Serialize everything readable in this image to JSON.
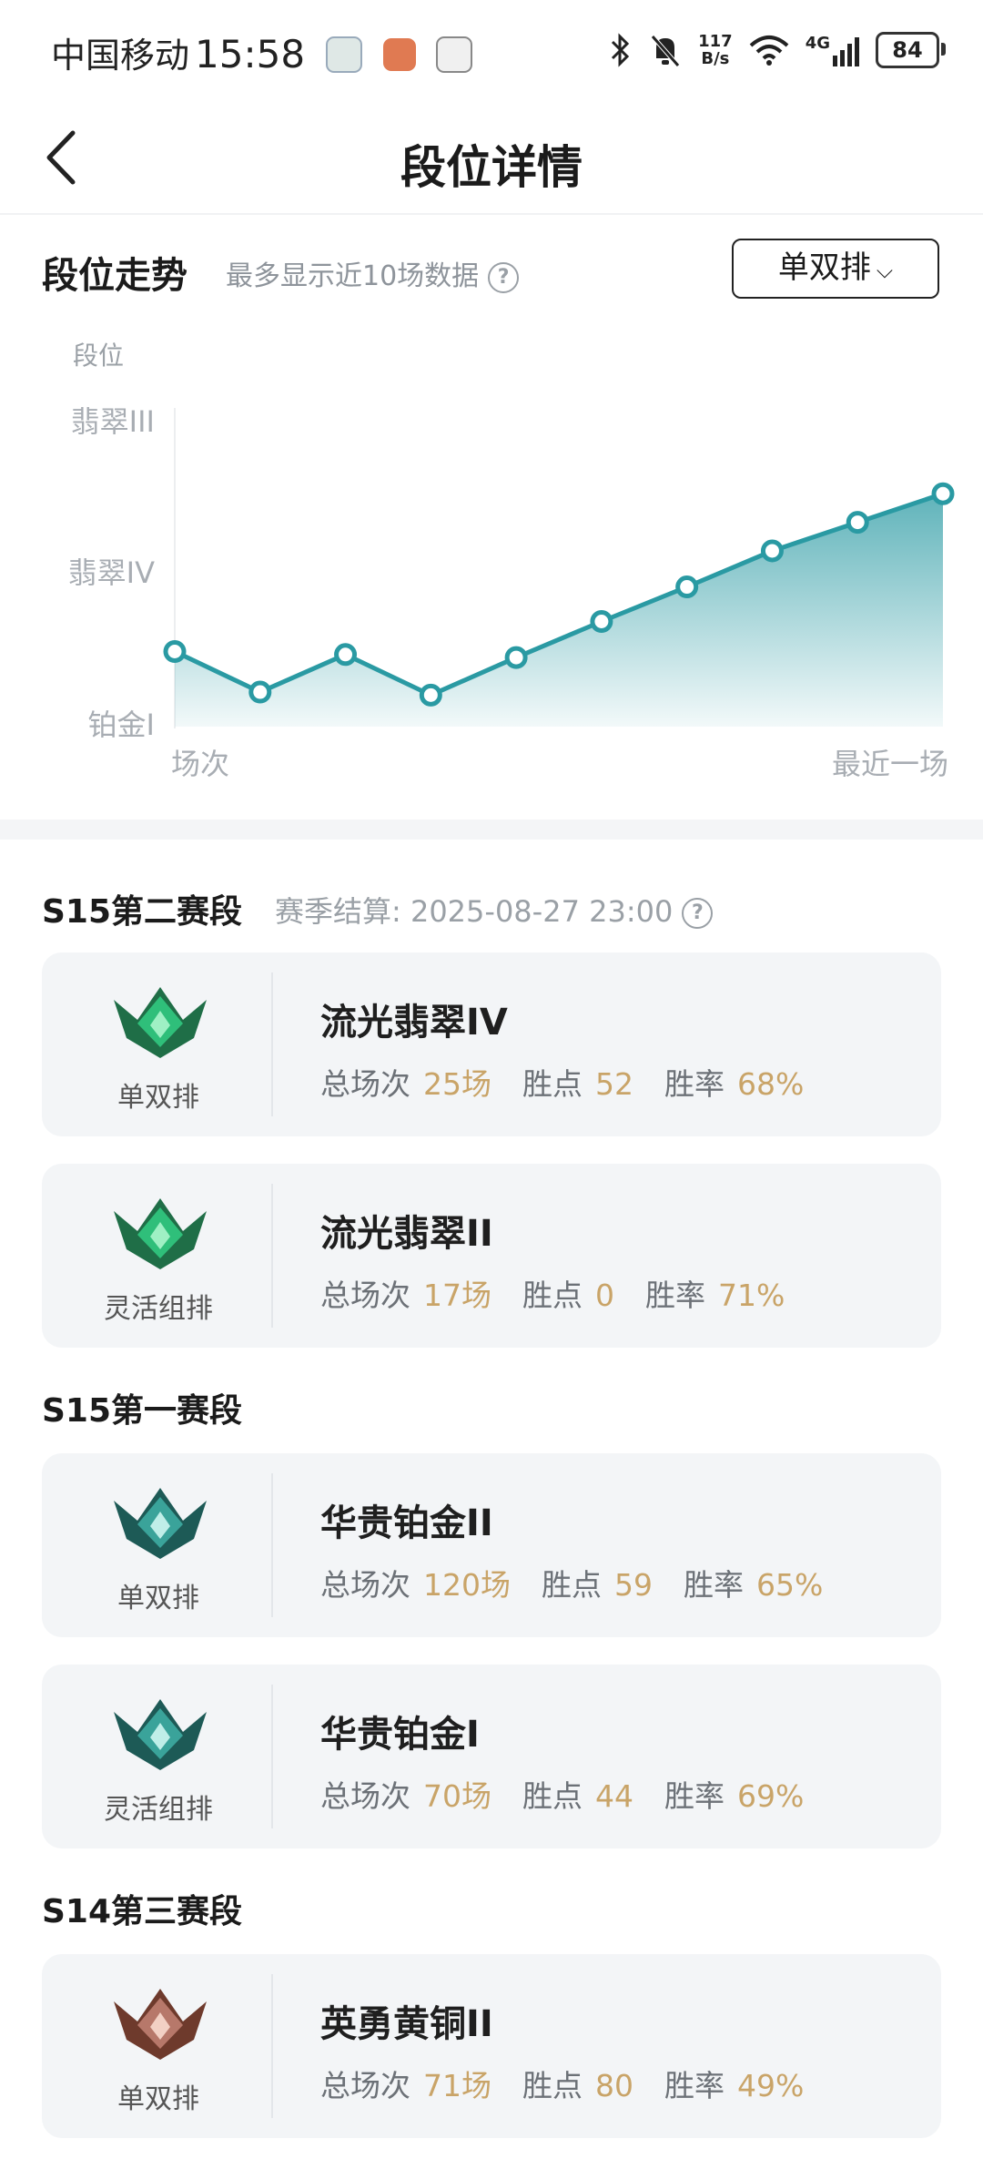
{
  "status_bar": {
    "carrier": "中国移动",
    "time": "15:58",
    "net_speed_value": "117",
    "net_speed_unit": "B/s",
    "network": "4G",
    "battery": "84"
  },
  "header": {
    "title": "段位详情"
  },
  "trend": {
    "title": "段位走势",
    "hint": "最多显示近10场数据",
    "queue_selected": "单双排",
    "y_title": "段位",
    "y_ticks": [
      "翡翠III",
      "翡翠IV",
      "铂金I"
    ],
    "x_start": "场次",
    "x_end": "最近一场",
    "line_color": "#2a9aa3"
  },
  "chart_data": {
    "type": "area",
    "x": [
      1,
      2,
      3,
      4,
      5,
      6,
      7,
      8,
      9,
      10
    ],
    "ylabel": "段位",
    "xlabel": "场次",
    "y_ticks": [
      {
        "label": "铂金I",
        "value": 0
      },
      {
        "label": "翡翠IV",
        "value": 100
      },
      {
        "label": "翡翠III",
        "value": 200
      }
    ],
    "ylim": [
      0,
      200
    ],
    "values": [
      50,
      23,
      48,
      21,
      46,
      70,
      93,
      117,
      136,
      155
    ]
  },
  "seasons": [
    {
      "name": "S15第二赛段",
      "note": "赛季结算: 2025-08-27 23:00",
      "cards": [
        {
          "queue": "单双排",
          "rank": "流光翡翠IV",
          "games_label": "总场次",
          "games": "25场",
          "lp_label": "胜点",
          "lp": "52",
          "wr_label": "胜率",
          "wr": "68%",
          "emblem": "emerald-emblem-icon"
        },
        {
          "queue": "灵活组排",
          "rank": "流光翡翠II",
          "games_label": "总场次",
          "games": "17场",
          "lp_label": "胜点",
          "lp": "0",
          "wr_label": "胜率",
          "wr": "71%",
          "emblem": "emerald-emblem-icon"
        }
      ]
    },
    {
      "name": "S15第一赛段",
      "cards": [
        {
          "queue": "单双排",
          "rank": "华贵铂金II",
          "games_label": "总场次",
          "games": "120场",
          "lp_label": "胜点",
          "lp": "59",
          "wr_label": "胜率",
          "wr": "65%",
          "emblem": "platinum-emblem-icon"
        },
        {
          "queue": "灵活组排",
          "rank": "华贵铂金I",
          "games_label": "总场次",
          "games": "70场",
          "lp_label": "胜点",
          "lp": "44",
          "wr_label": "胜率",
          "wr": "69%",
          "emblem": "platinum-emblem-icon"
        }
      ]
    },
    {
      "name": "S14第三赛段",
      "cards": [
        {
          "queue": "单双排",
          "rank": "英勇黄铜II",
          "games_label": "总场次",
          "games": "71场",
          "lp_label": "胜点",
          "lp": "80",
          "wr_label": "胜率",
          "wr": "49%",
          "emblem": "bronze-emblem-icon"
        }
      ]
    }
  ],
  "colors": {
    "accent": "#2a9aa3",
    "value_gold": "#c9a468",
    "card_bg": "#f3f5f7"
  }
}
